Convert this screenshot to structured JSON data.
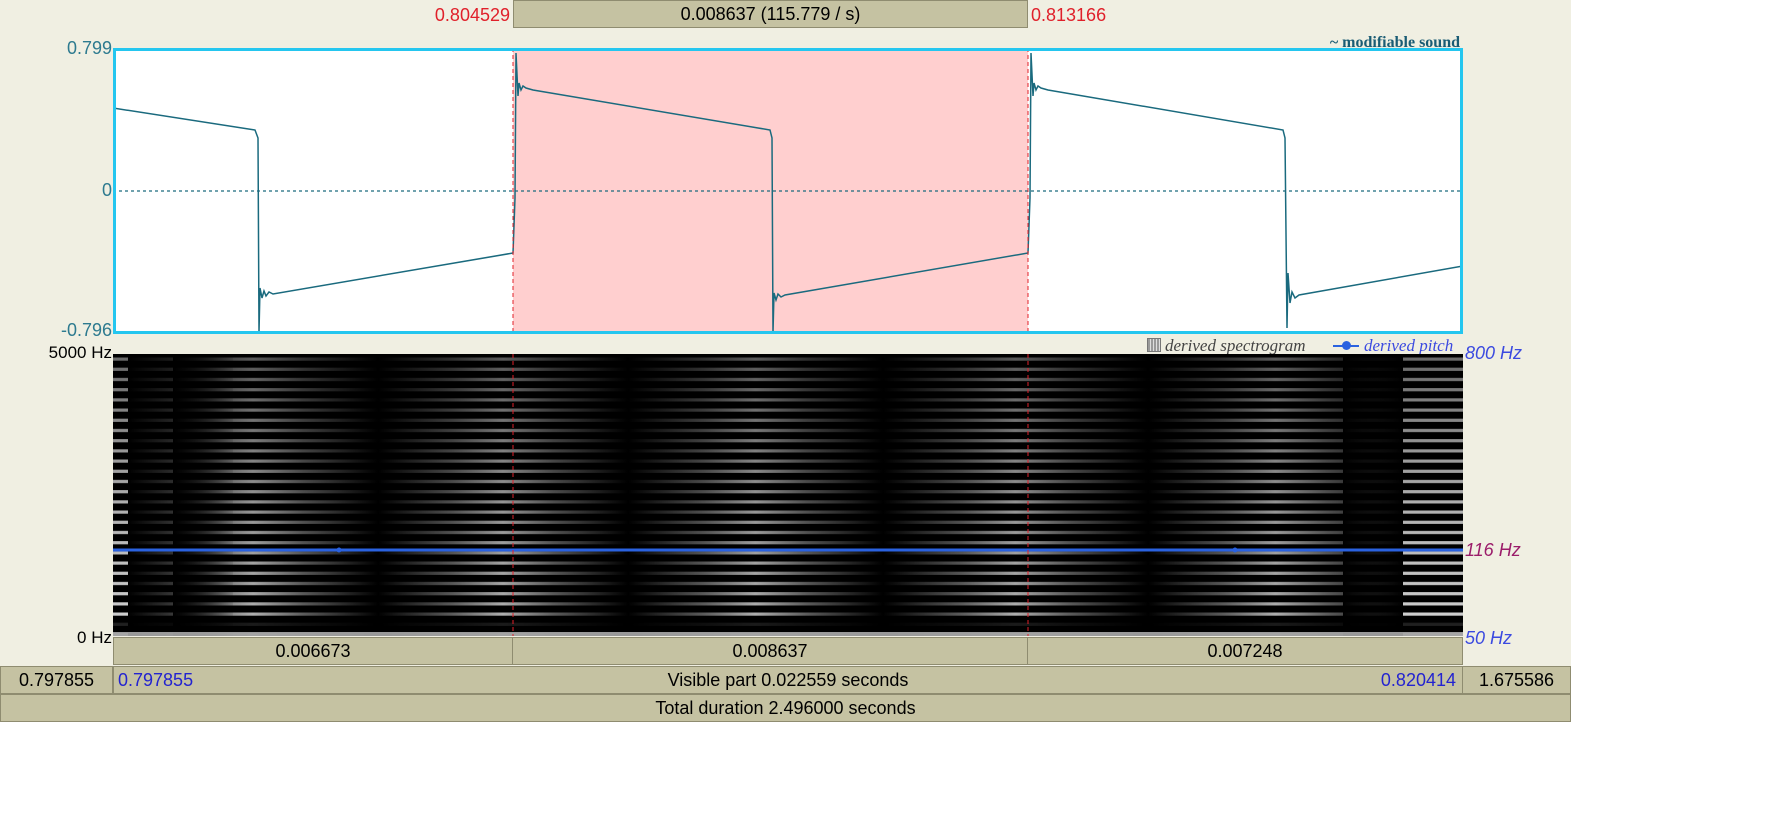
{
  "selection": {
    "start_label": "0.804529",
    "end_label": "0.813166",
    "duration_label": "0.008637 (115.779 / s)"
  },
  "waveform": {
    "ymax_label": "0.799",
    "zero_label": "0",
    "ymin_label": "-0.796",
    "name_label": "~ modifiable sound",
    "line_color": "#1a6a7e",
    "selection_color": "#ffcfcf",
    "frame_color": "#24c6ef"
  },
  "spectrogram": {
    "ymax_label": "5000 Hz",
    "ymin_label": "0 Hz",
    "legend_spec_label": "derived spectrogram",
    "legend_pitch_label": "derived pitch",
    "pitch_max_label": "800 Hz",
    "pitch_value_label": "116 Hz",
    "pitch_min_label": "50 Hz",
    "pitch_color": "#2a62e0"
  },
  "segments": {
    "left": "0.006673",
    "mid": "0.008637",
    "right": "0.007248"
  },
  "visible_bar": {
    "outer_left": "0.797855",
    "inner_left": "0.797855",
    "center": "Visible part 0.022559 seconds",
    "inner_right": "0.820414",
    "outer_right": "1.675586"
  },
  "total_bar": {
    "label": "Total duration 2.496000 seconds"
  }
}
